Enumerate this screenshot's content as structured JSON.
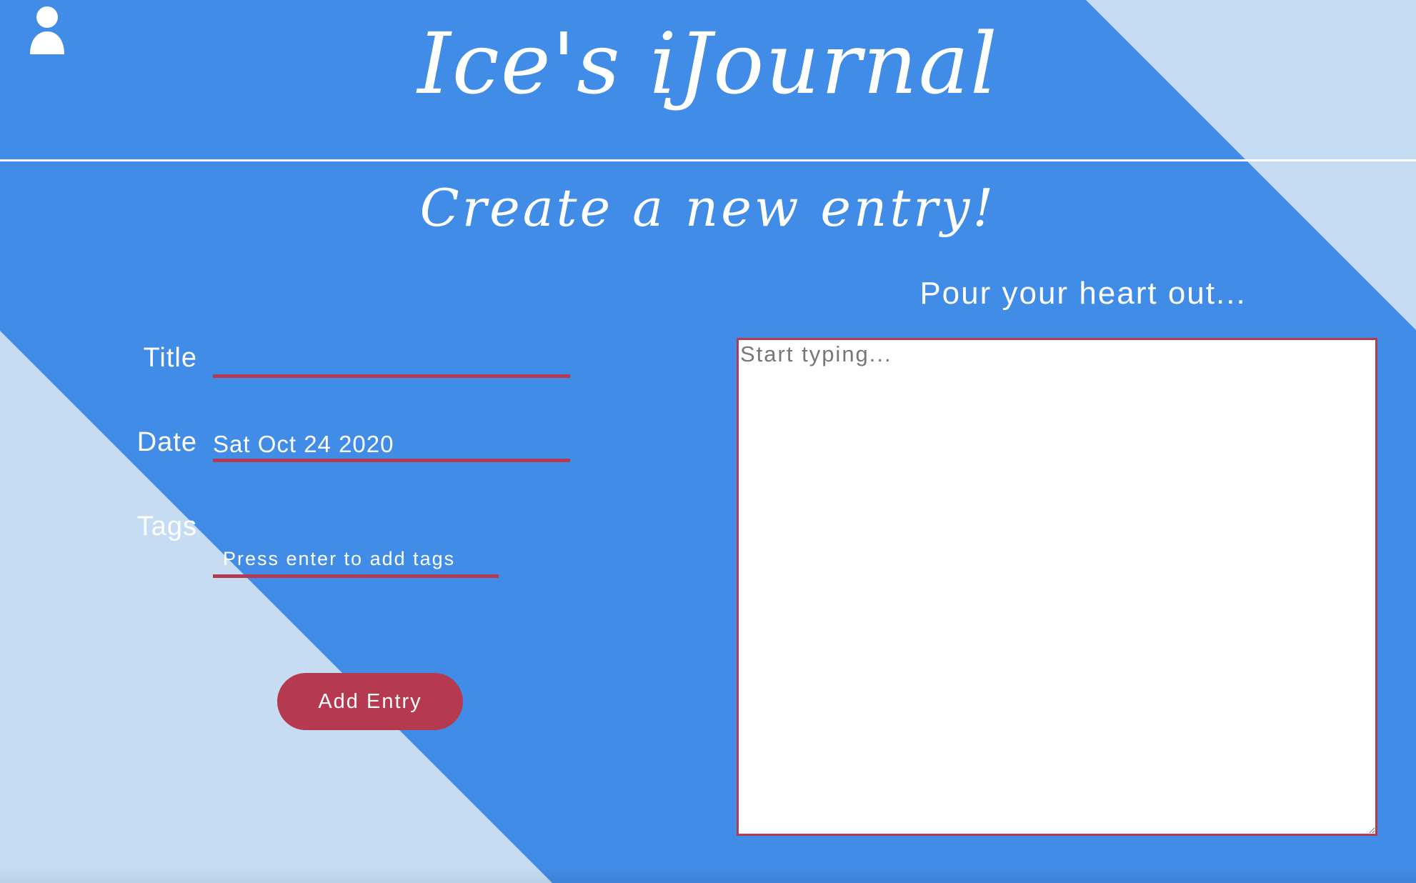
{
  "header": {
    "app_title": "Ice's iJournal",
    "user_icon": "user-icon"
  },
  "page": {
    "heading": "Create a new entry!"
  },
  "form": {
    "title_label": "Title",
    "title_value": "",
    "date_label": "Date",
    "date_value": "Sat Oct 24 2020",
    "tags_label": "Tags",
    "tags_placeholder": "Press enter to add tags",
    "submit_label": "Add Entry"
  },
  "editor": {
    "heading": "Pour your heart out...",
    "placeholder": "Start typing...",
    "value": ""
  },
  "colors": {
    "background": "#418ce6",
    "background_light": "#c5dcf3",
    "accent": "#b5394f",
    "text": "#ffffff"
  }
}
